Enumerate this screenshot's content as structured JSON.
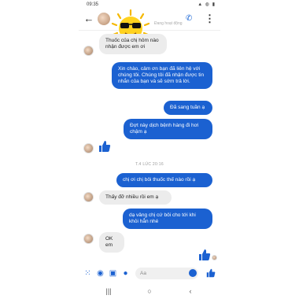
{
  "status_bar": {
    "time": "09:35",
    "icons": "▲ ◍ ▮"
  },
  "header": {
    "subtitle": "Đang hoạt động"
  },
  "messages": [
    {
      "dir": "in",
      "text": "Thuốc của chị hôm nào nhận được em ơi"
    },
    {
      "dir": "out",
      "text": "Xin chào, cảm ơn bạn đã liên hệ với chúng tôi. Chúng tôi đã nhận được tin nhắn của bạn và sẽ sớm trả lời."
    },
    {
      "dir": "out",
      "text": "Đã sang tuần ạ"
    },
    {
      "dir": "out",
      "text": "Đợt này dịch bệnh hàng đi hơi chậm ạ"
    },
    {
      "dir": "out",
      "text": "chị ơi chị bôi thuốc thế nào rồi ạ"
    },
    {
      "dir": "in",
      "text": "Thấy đỡ nhiều rồi em ạ"
    },
    {
      "dir": "out",
      "text": "dạ vâng chị cứ bôi cho tới khi khỏi hẳn nhé"
    },
    {
      "dir": "in",
      "text": "OK em"
    }
  ],
  "timestamp": "T.4 LÚC 20:16",
  "composer": {
    "placeholder": "Aa"
  },
  "navbar": {
    "recents": "|||",
    "home": "○",
    "back": "‹"
  },
  "colors": {
    "accent": "#1b61d1",
    "incoming_bubble": "#ececec"
  },
  "icons": [
    "back-arrow-icon",
    "sun-sunglasses-sticker",
    "phone-icon",
    "menu-dots-icon",
    "thumbs-up-icon",
    "grid-icon",
    "camera-icon",
    "image-icon",
    "mic-icon",
    "emoji-icon"
  ]
}
